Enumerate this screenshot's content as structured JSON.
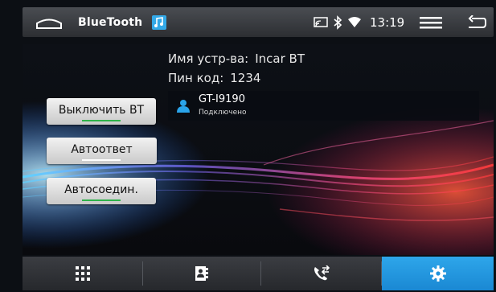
{
  "status_bar": {
    "app_title": "BlueTooth",
    "clock": "13:19",
    "icons": [
      "home-icon",
      "bluetooth-music-icon",
      "screen-cast-icon",
      "bluetooth-icon",
      "wifi-icon",
      "menu-icon",
      "back-icon"
    ]
  },
  "device_info": {
    "name_label": "Имя устр-ва:",
    "name_value": "Incar BT",
    "pin_label": "Пин код:",
    "pin_value": "1234"
  },
  "paired_device": {
    "model": "GT-I9190",
    "status": "Подключено"
  },
  "buttons": {
    "bt_off": "Выключить ВТ",
    "auto_answer": "Автоответ",
    "auto_connect": "Автосоедин."
  },
  "toggle_colors": {
    "on": "#2fb34a",
    "off": "#ffffff"
  },
  "bottom_nav": {
    "tabs": [
      "apps-grid-icon",
      "contacts-icon",
      "call-log-icon",
      "settings-gear-icon"
    ],
    "active_tab": "settings",
    "active_color": "#1e92dc"
  }
}
